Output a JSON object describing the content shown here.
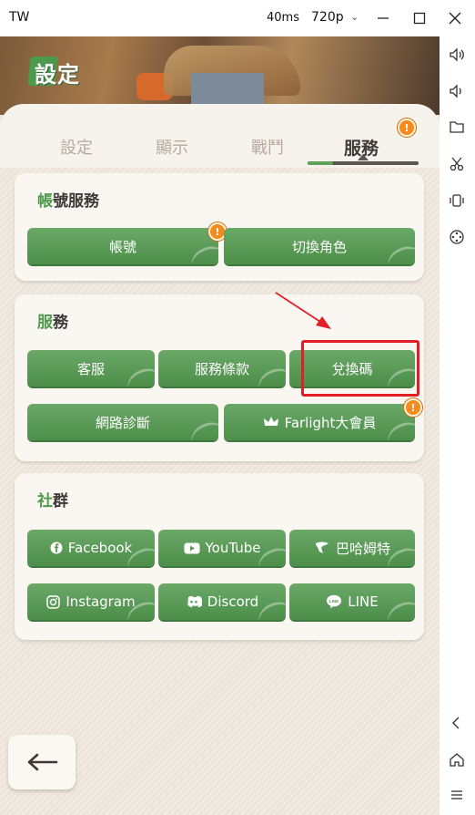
{
  "window": {
    "title": "TW",
    "fps": "40ms",
    "resolution": "720p"
  },
  "window_controls": [
    "minimize-icon",
    "maximize-icon",
    "close-icon"
  ],
  "sidebar_icons": [
    "volume-up-icon",
    "volume-down-icon",
    "folder-icon",
    "scissors-icon",
    "rotate-icon",
    "gamepad-icon",
    "back-icon",
    "home-icon",
    "menu-icon"
  ],
  "banner": {
    "logo_text": "設定"
  },
  "tabs": [
    {
      "label": "設定",
      "active": false
    },
    {
      "label": "顯示",
      "active": false
    },
    {
      "label": "戰鬥",
      "active": false
    },
    {
      "label": "服務",
      "active": true,
      "badge": "!"
    }
  ],
  "sections": {
    "account": {
      "title_first": "帳",
      "title_rest": "號服務",
      "buttons": [
        {
          "label": "帳號",
          "badge": "!"
        },
        {
          "label": "切換角色"
        }
      ]
    },
    "service": {
      "title_first": "服",
      "title_rest": "務",
      "buttons": [
        {
          "label": "客服"
        },
        {
          "label": "服務條款"
        },
        {
          "label": "兌換碼"
        },
        {
          "label": "網路診斷"
        },
        {
          "label": "Farlight大會員",
          "icon": "crown-icon",
          "badge": "!"
        }
      ]
    },
    "community": {
      "title_first": "社",
      "title_rest": "群",
      "buttons": [
        {
          "label": "Facebook",
          "icon": "facebook-icon"
        },
        {
          "label": "YouTube",
          "icon": "youtube-icon"
        },
        {
          "label": "巴哈姆特",
          "icon": "bahamut-icon"
        },
        {
          "label": "Instagram",
          "icon": "instagram-icon"
        },
        {
          "label": "Discord",
          "icon": "discord-icon"
        },
        {
          "label": "LINE",
          "icon": "line-icon"
        }
      ]
    }
  },
  "colors": {
    "button_green": "#5a9b57",
    "highlight_red": "#e01f26",
    "badge_orange": "#f58a1f",
    "annotation_arrow_red": "#e01f26"
  }
}
